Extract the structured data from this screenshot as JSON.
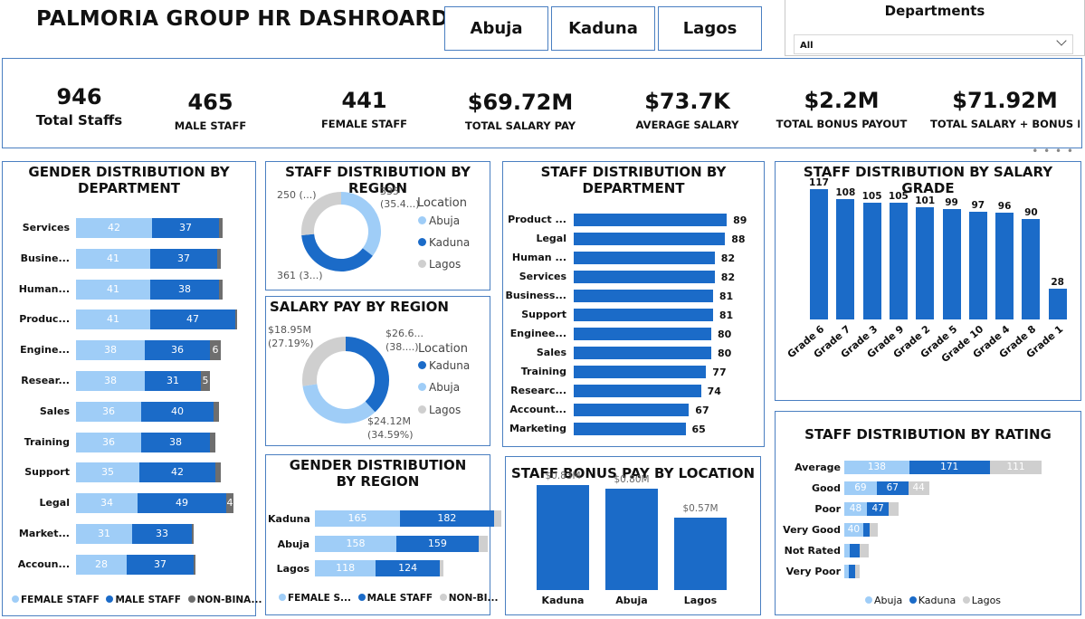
{
  "header": {
    "title": "PALMORIA GROUP HR DASHROARD",
    "locations": [
      "Abuja",
      "Kaduna",
      "Lagos"
    ],
    "departments_label": "Departments",
    "departments_value": "All"
  },
  "kpis": [
    {
      "value": "946",
      "label": "Total Staffs"
    },
    {
      "value": "465",
      "label": "MALE STAFF"
    },
    {
      "value": "441",
      "label": "FEMALE STAFF"
    },
    {
      "value": "$69.72M",
      "label": "TOTAL SALARY PAY"
    },
    {
      "value": "$73.7K",
      "label": "AVERAGE SALARY"
    },
    {
      "value": "$2.2M",
      "label": "TOTAL BONUS PAYOUT"
    },
    {
      "value": "$71.92M",
      "label": "TOTAL SALARY + BONUS P..."
    }
  ],
  "colors": {
    "female": "#9fcdf7",
    "male": "#1b6bc8",
    "nonbinary": "#6e6e6e",
    "lagos": "#cfcfcf",
    "bar": "#1b6bc8",
    "border": "#4a7fc1"
  },
  "chart_data": [
    {
      "id": "gender_by_department",
      "type": "bar",
      "title": "GENDER DISTRIBUTION BY DEPARTMENT",
      "categories": [
        "Services",
        "Busine...",
        "Human...",
        "Produc...",
        "Engine...",
        "Resear...",
        "Sales",
        "Training",
        "Support",
        "Legal",
        "Market...",
        "Accoun..."
      ],
      "series": [
        {
          "name": "FEMALE STAFF",
          "values": [
            42,
            41,
            41,
            41,
            38,
            38,
            36,
            36,
            35,
            34,
            31,
            28
          ]
        },
        {
          "name": "MALE STAFF",
          "values": [
            37,
            37,
            38,
            47,
            36,
            31,
            40,
            38,
            42,
            49,
            33,
            37
          ]
        },
        {
          "name": "NON-BINA...",
          "values": [
            2,
            2,
            2,
            1,
            6,
            5,
            3,
            3,
            3,
            4,
            1,
            1
          ]
        }
      ],
      "legend": [
        "FEMALE STAFF",
        "MALE STAFF",
        "NON-BINA..."
      ]
    },
    {
      "id": "staff_by_region",
      "type": "pie",
      "title": "STAFF DISTRIBUTION BY REGION",
      "legend_title": "Location",
      "labels": [
        "Abuja",
        "Kaduna",
        "Lagos"
      ],
      "values": [
        335,
        361,
        250
      ],
      "data_labels": [
        "335",
        "(35.4...)",
        "361 (3...)",
        "250 (...)"
      ]
    },
    {
      "id": "salary_by_region",
      "type": "pie",
      "title": "SALARY PAY BY REGION",
      "legend_title": "Location",
      "labels": [
        "Kaduna",
        "Abuja",
        "Lagos"
      ],
      "values": [
        26.6,
        24.12,
        18.95
      ],
      "data_labels": [
        "$26.6...",
        "(38....)",
        "$24.12M",
        "(34.59%)",
        "$18.95M",
        "(27.19%)"
      ]
    },
    {
      "id": "staff_by_department",
      "type": "bar",
      "title": "STAFF DISTRIBUTION BY DEPARTMENT",
      "categories": [
        "Product ...",
        "Legal",
        "Human ...",
        "Services",
        "Business...",
        "Support",
        "Enginee...",
        "Sales",
        "Training",
        "Researc...",
        "Account...",
        "Marketing"
      ],
      "values": [
        89,
        88,
        82,
        82,
        81,
        81,
        80,
        80,
        77,
        74,
        67,
        65
      ]
    },
    {
      "id": "staff_by_salary_grade",
      "type": "bar",
      "title": "STAFF DISTRIBUTION BY SALARY GRADE",
      "categories": [
        "Grade 6",
        "Grade 7",
        "Grade 3",
        "Grade 9",
        "Grade 2",
        "Grade 5",
        "Grade 10",
        "Grade 4",
        "Grade 8",
        "Grade 1"
      ],
      "values": [
        117,
        108,
        105,
        105,
        101,
        99,
        97,
        96,
        90,
        28
      ]
    },
    {
      "id": "gender_by_region",
      "type": "bar",
      "title": "GENDER DISTRIBUTION BY REGION",
      "categories": [
        "Kaduna",
        "Abuja",
        "Lagos"
      ],
      "series": [
        {
          "name": "FEMALE S...",
          "values": [
            165,
            158,
            118
          ]
        },
        {
          "name": "MALE STAFF",
          "values": [
            182,
            159,
            124
          ]
        },
        {
          "name": "NON-BI...",
          "values": [
            14,
            18,
            8
          ]
        }
      ],
      "legend": [
        "FEMALE S...",
        "MALE STAFF",
        "NON-BI..."
      ]
    },
    {
      "id": "bonus_by_location",
      "type": "bar",
      "title": "STAFF BONUS PAY BY LOCATION",
      "categories": [
        "Kaduna",
        "Abuja",
        "Lagos"
      ],
      "values": [
        0.83,
        0.8,
        0.57
      ],
      "value_labels": [
        "$0.83M",
        "$0.80M",
        "$0.57M"
      ]
    },
    {
      "id": "staff_by_rating",
      "type": "bar",
      "title": "STAFF DISTRIBUTION BY RATING",
      "categories": [
        "Average",
        "Good",
        "Poor",
        "Very Good",
        "Not Rated",
        "Very Poor"
      ],
      "series": [
        {
          "name": "Abuja",
          "values": [
            138,
            69,
            48,
            40,
            12,
            9
          ]
        },
        {
          "name": "Kaduna",
          "values": [
            171,
            67,
            47,
            14,
            20,
            14
          ]
        },
        {
          "name": "Lagos",
          "values": [
            111,
            44,
            20,
            18,
            19,
            10
          ]
        }
      ],
      "legend": [
        "Abuja",
        "Kaduna",
        "Lagos"
      ]
    }
  ]
}
